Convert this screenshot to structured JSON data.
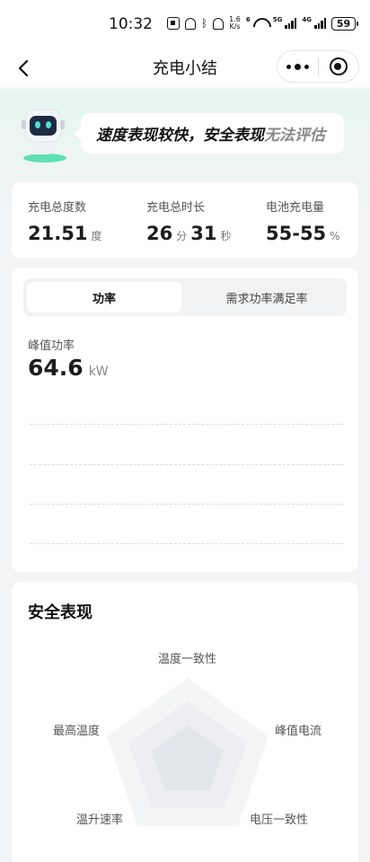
{
  "status_bar": {
    "time": "10:32",
    "net_speed_value": "1.6",
    "net_speed_unit": "K/s",
    "wifi_label": "6",
    "network_5g": "5G",
    "network_4g": "4G",
    "battery": "59"
  },
  "nav": {
    "title": "充电小结"
  },
  "summary": {
    "text_main": "速度表现较快，安全表现",
    "text_muted": "无法评估"
  },
  "stats": [
    {
      "label": "充电总度数",
      "value": "21.51",
      "unit": "度"
    },
    {
      "label": "充电总时长",
      "minutes": "26",
      "minutes_unit": "分",
      "seconds": "31",
      "seconds_unit": "秒"
    },
    {
      "label": "电池充电量",
      "value": "55-55",
      "unit": "%"
    }
  ],
  "power": {
    "tabs": [
      "功率",
      "需求功率满足率"
    ],
    "active_tab": "功率",
    "peak_label": "峰值功率",
    "peak_value": "64.6",
    "peak_unit": "kW"
  },
  "safety": {
    "title": "安全表现",
    "axes": [
      "温度一致性",
      "峰值电流",
      "电压一致性",
      "温升速率",
      "最高温度"
    ]
  },
  "colors": {
    "accent": "#3fd6a3",
    "header_tint": "#e6f6f0",
    "page_bg": "#f2f4f5"
  },
  "icons": {
    "back": "chevron-left-icon",
    "more": "more-dots-icon",
    "close": "target-ring-icon",
    "robot": "robot-mascot-icon"
  }
}
